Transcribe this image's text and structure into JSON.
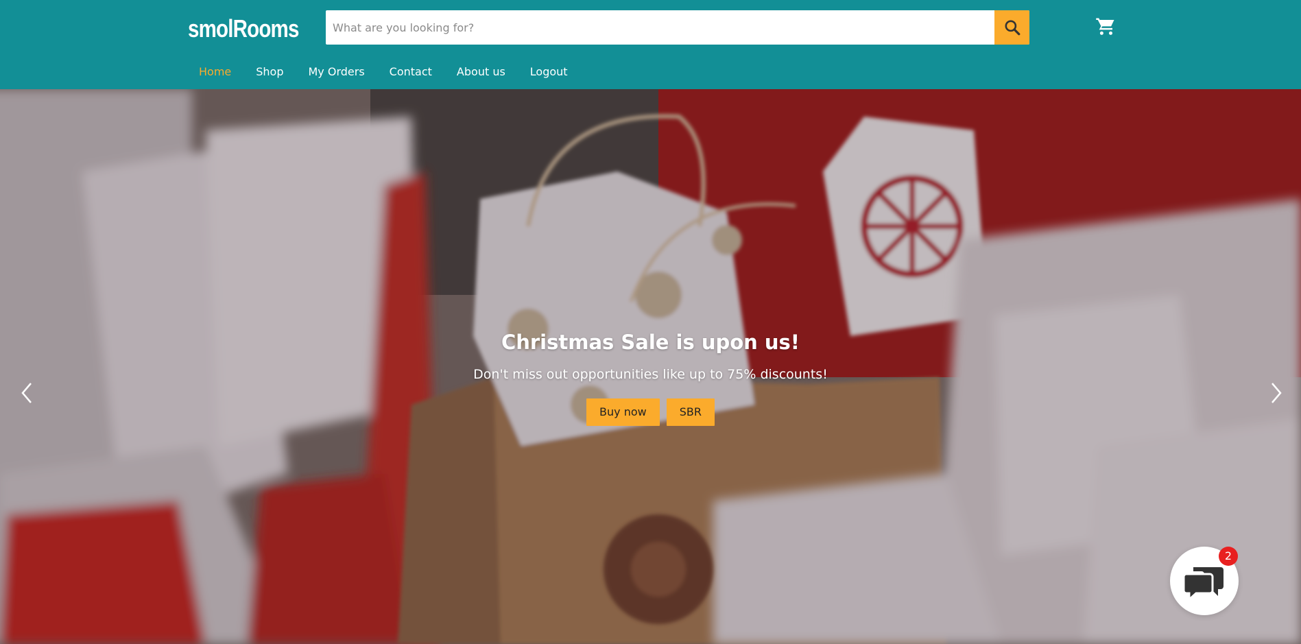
{
  "header": {
    "logo": "smolRooms",
    "search": {
      "placeholder": "What are you looking for?",
      "value": ""
    },
    "icons": {
      "search": "search-icon",
      "cart": "cart-icon"
    },
    "nav": [
      {
        "label": "Home",
        "active": true
      },
      {
        "label": "Shop",
        "active": false
      },
      {
        "label": "My Orders",
        "active": false
      },
      {
        "label": "Contact",
        "active": false
      },
      {
        "label": "About us",
        "active": false
      },
      {
        "label": "Logout",
        "active": false
      }
    ]
  },
  "hero": {
    "title": "Christmas Sale is upon us!",
    "subtitle": "Don't miss out opportunities like up to 75% discounts!",
    "buttons": [
      {
        "label": "Buy now"
      },
      {
        "label": "SBR"
      }
    ],
    "icons": {
      "prev": "chevron-left-icon",
      "next": "chevron-right-icon"
    }
  },
  "chat": {
    "badge_count": "2",
    "icon": "chat-bubbles-icon"
  },
  "colors": {
    "header_bg": "#128f96",
    "accent": "#fbab2c",
    "badge": "#e82020"
  }
}
